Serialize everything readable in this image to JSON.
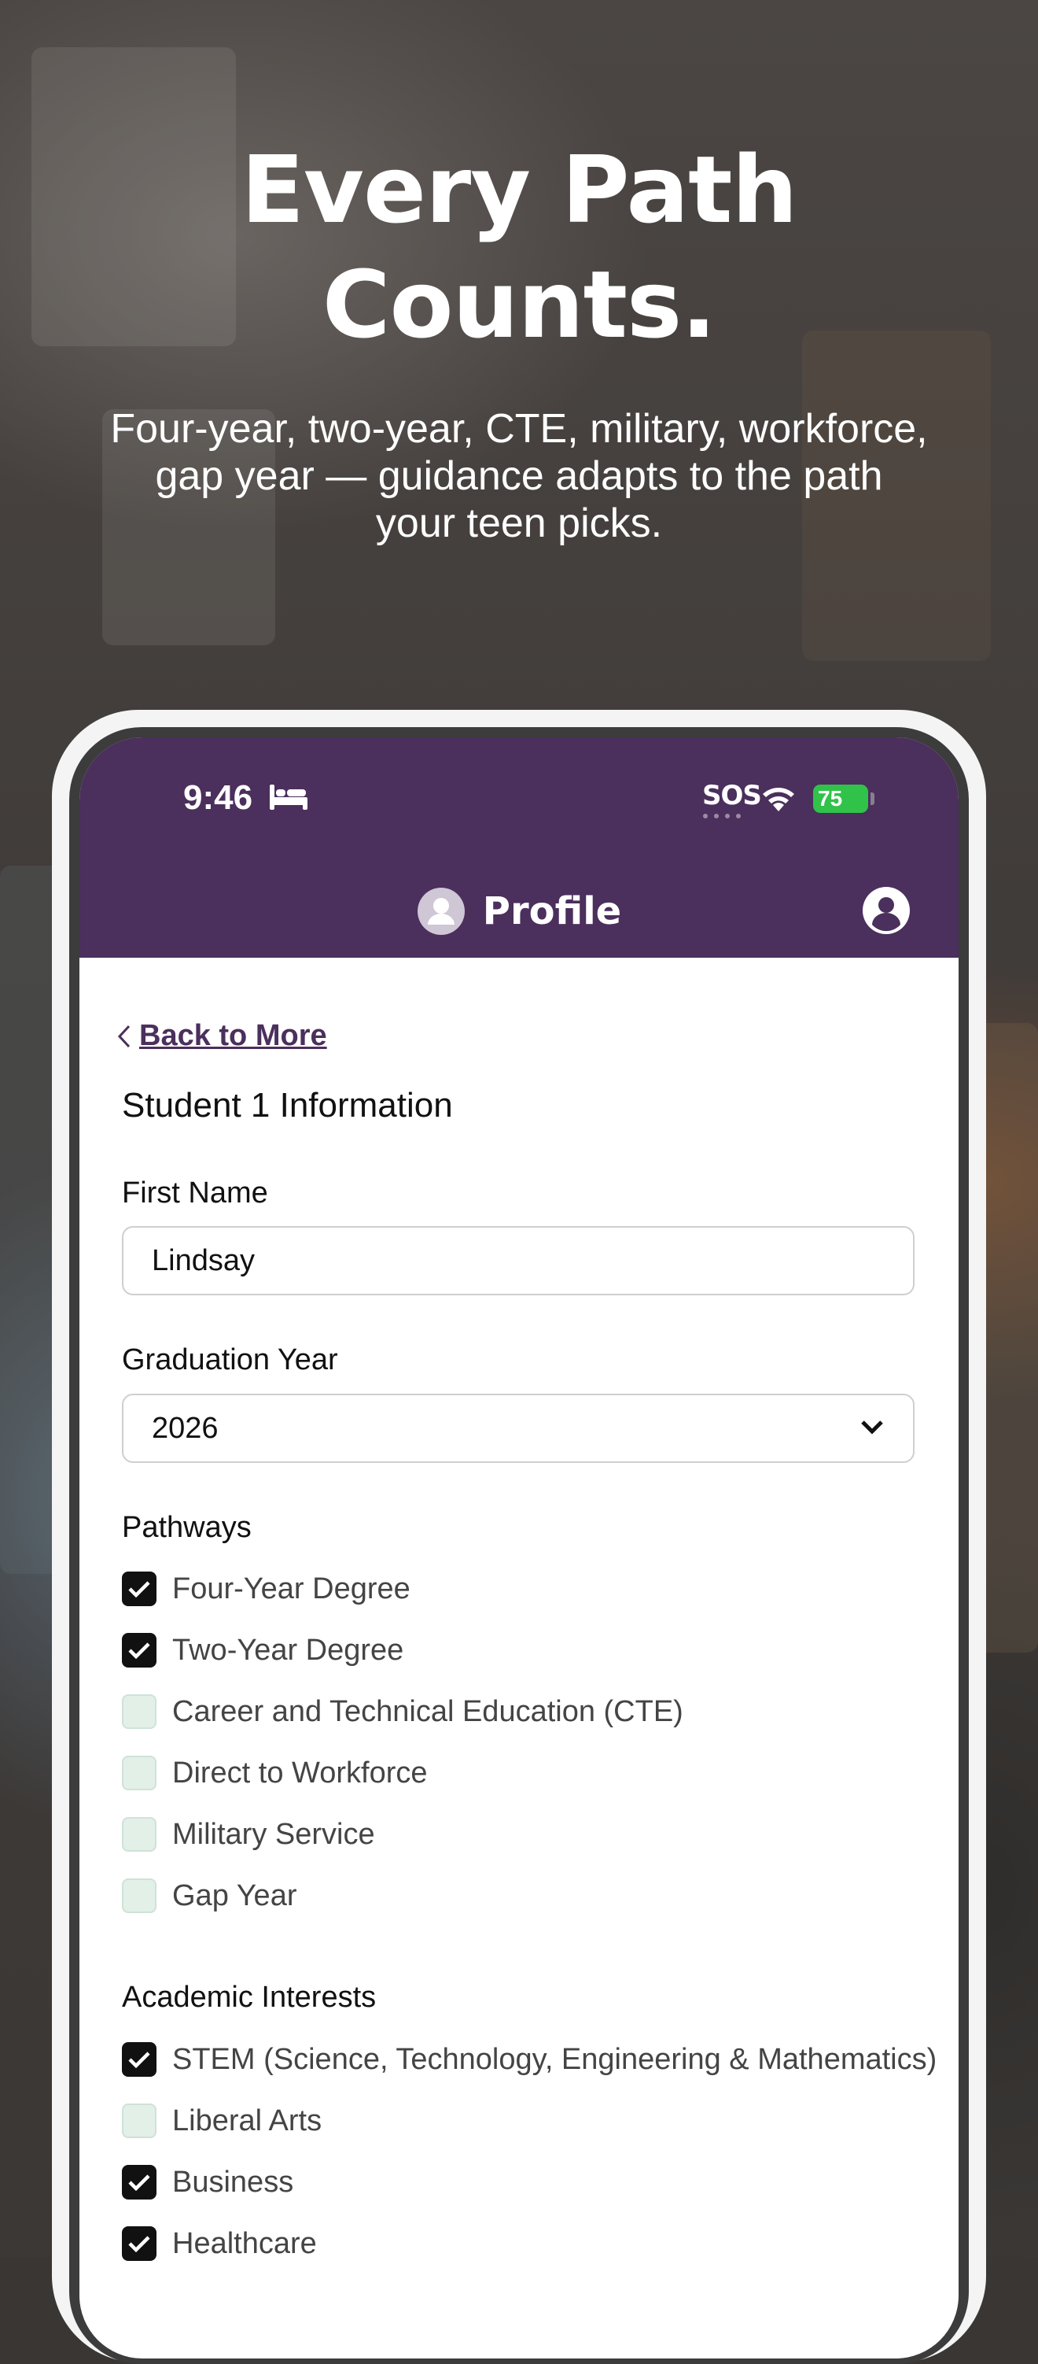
{
  "marketing": {
    "headline_line1": "Every Path",
    "headline_line2": "Counts.",
    "subhead": "Four-year, two-year, CTE, military, workforce, gap year — guidance adapts to the path your teen picks."
  },
  "status_bar": {
    "time": "9:46",
    "sos": "SOS",
    "battery": "75"
  },
  "header": {
    "title": "Profile"
  },
  "back_link": "Back to More",
  "section_title": "Student 1 Information",
  "first_name": {
    "label": "First Name",
    "value": "Lindsay"
  },
  "graduation_year": {
    "label": "Graduation Year",
    "value": "2026"
  },
  "pathways": {
    "label": "Pathways",
    "items": [
      {
        "label": "Four-Year Degree",
        "checked": true
      },
      {
        "label": "Two-Year Degree",
        "checked": true
      },
      {
        "label": "Career and Technical Education (CTE)",
        "checked": false
      },
      {
        "label": "Direct to Workforce",
        "checked": false
      },
      {
        "label": "Military Service",
        "checked": false
      },
      {
        "label": "Gap Year",
        "checked": false
      }
    ]
  },
  "academic_interests": {
    "label": "Academic Interests",
    "items": [
      {
        "label": "STEM (Science, Technology, Engineering & Mathematics)",
        "checked": true
      },
      {
        "label": "Liberal Arts",
        "checked": false
      },
      {
        "label": "Business",
        "checked": true
      },
      {
        "label": "Healthcare",
        "checked": true
      }
    ]
  },
  "colors": {
    "header": "#4b2f5c",
    "checkbox_on": "#111111",
    "checkbox_off": "#e2f0e8",
    "battery": "#31c24a"
  }
}
